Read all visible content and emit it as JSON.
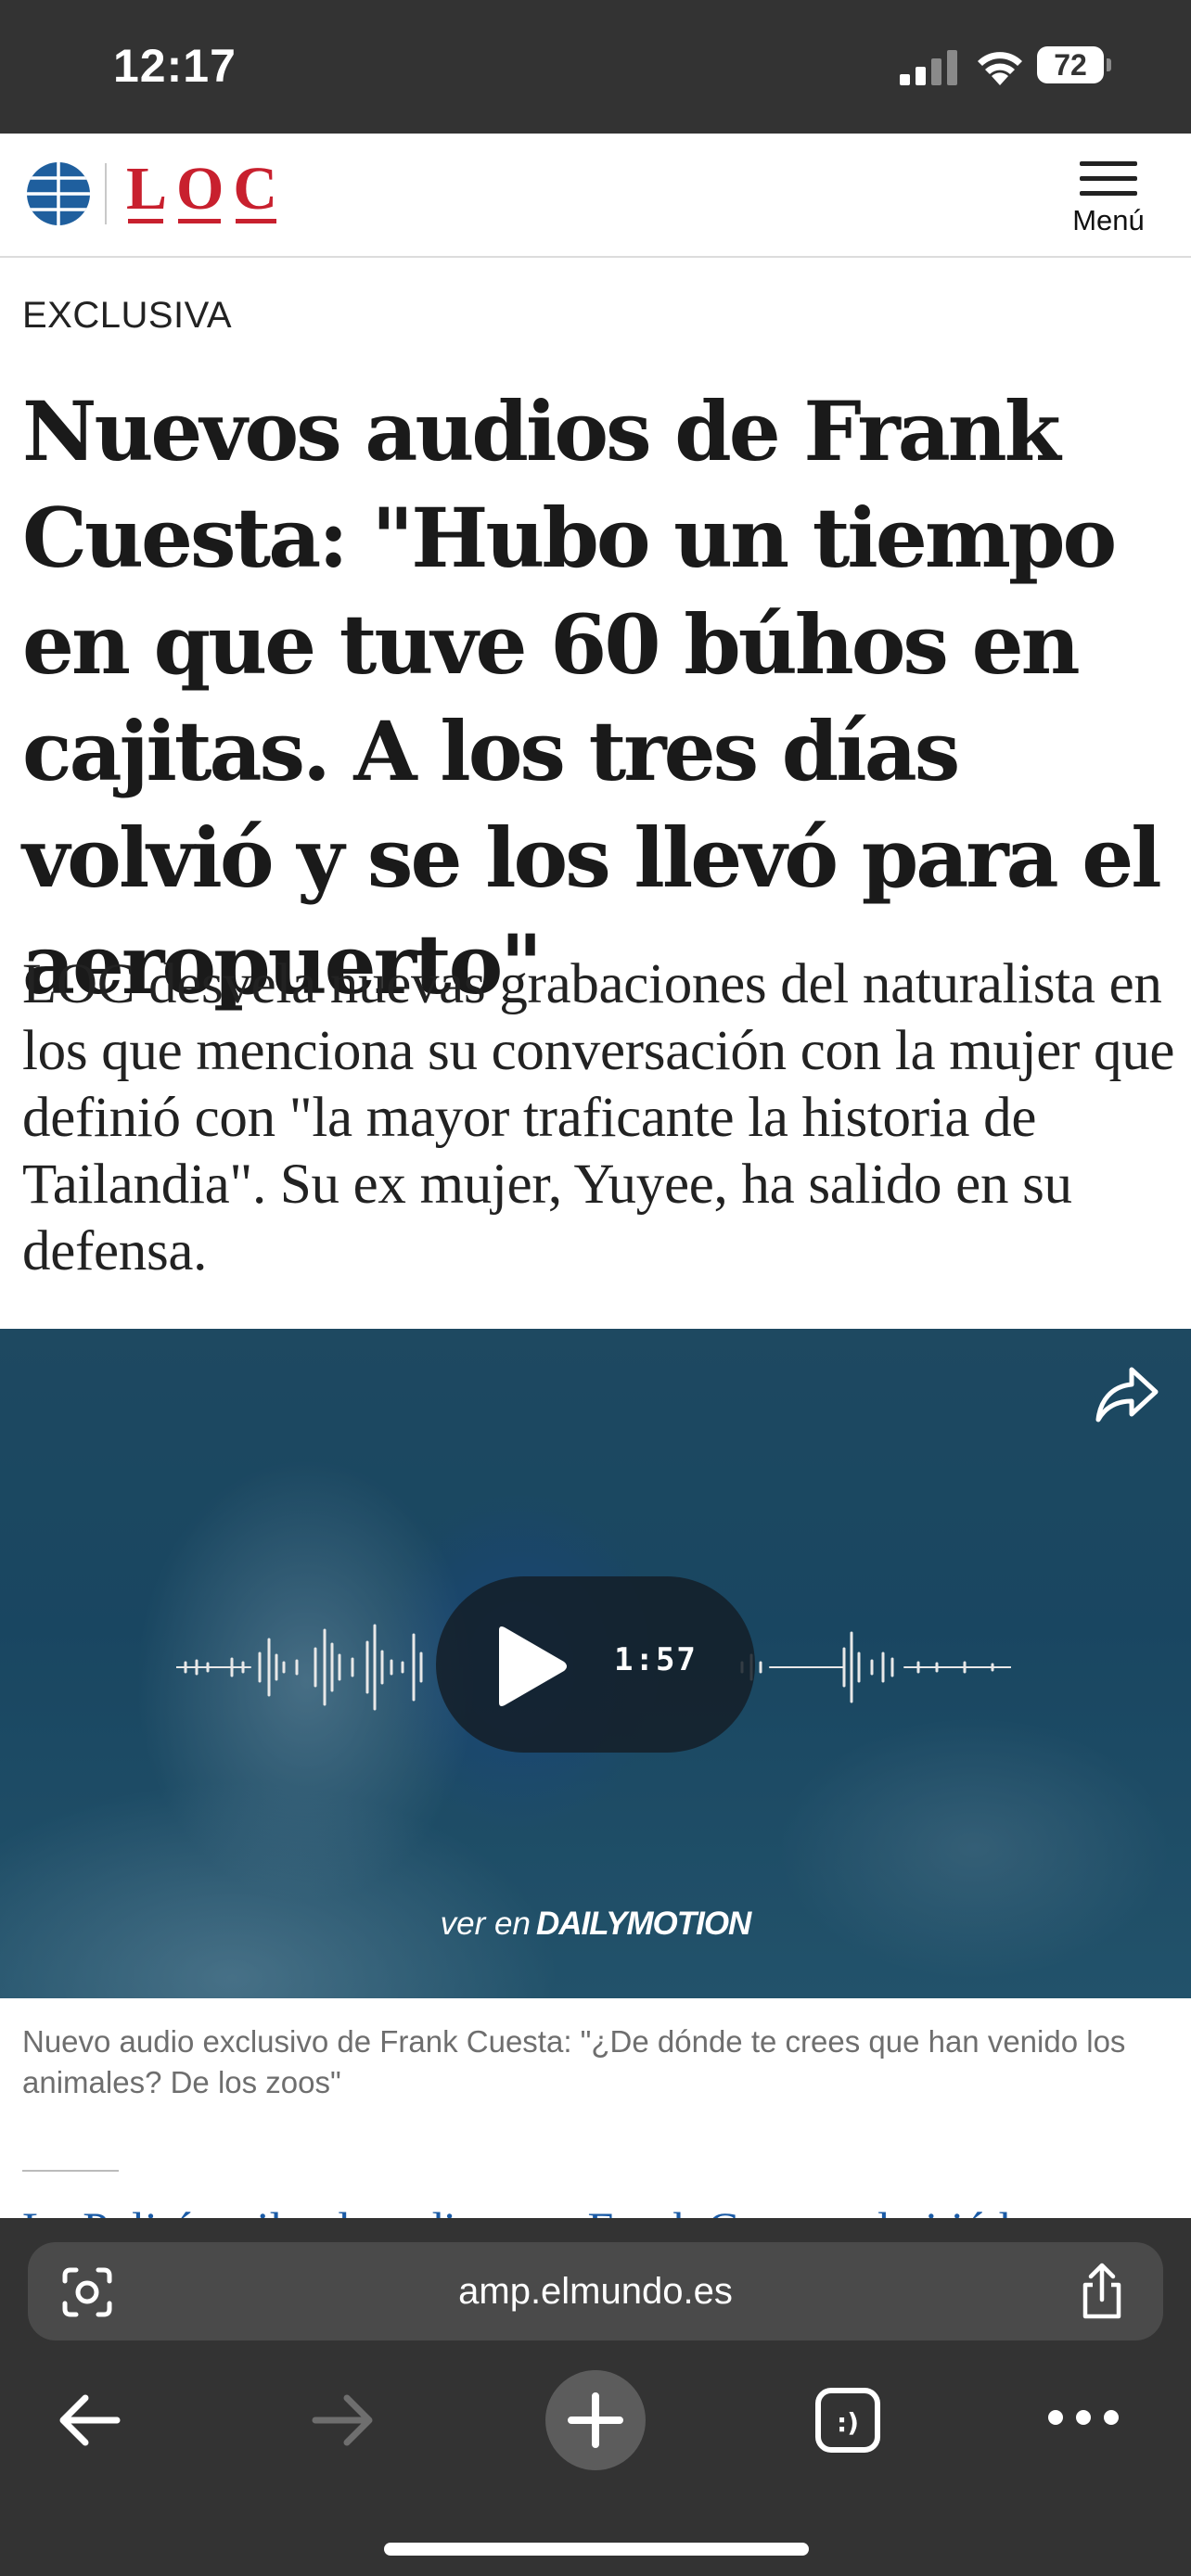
{
  "status_bar": {
    "time": "12:17",
    "battery": "72"
  },
  "header": {
    "logo": "LOC",
    "menu_label": "Menú"
  },
  "article": {
    "kicker": "EXCLUSIVA",
    "headline": "Nuevos audios de Frank Cuesta: \"Hubo un tiempo en que tuve 60 búhos en cajitas. A los tres días volvió y se los llevó para el aeropuerto\"",
    "standfirst": "LOC desvela nuevas grabaciones del naturalista en los que menciona su conversación con la mujer que definió con \"la mayor traficante la historia de Tailandia\". Su ex mujer, Yuyee, ha salido en su defensa.",
    "video": {
      "duration": "1:57",
      "watch_on": "ver en",
      "watch_on_brand": "DAILYMOTION"
    },
    "caption": "Nuevo audio exclusivo de Frank Cuesta: \"¿De dónde te crees que han venido los animales? De los zoos\"",
    "related_link": "La Policía tailandesa dice que Frank Cuesta admitió los"
  },
  "browser": {
    "url": "amp.elmundo.es"
  },
  "colors": {
    "brand_red": "#c8202e",
    "link_blue": "#1a5ba6",
    "chrome_dark": "#333333"
  },
  "icons": [
    "signal-icon",
    "wifi-icon",
    "battery-icon",
    "globe-icon",
    "hamburger-icon",
    "share-arrow-icon",
    "play-icon",
    "lens-icon",
    "share-icon",
    "back-arrow-icon",
    "forward-arrow-icon",
    "plus-icon",
    "tabs-icon",
    "more-icon"
  ]
}
